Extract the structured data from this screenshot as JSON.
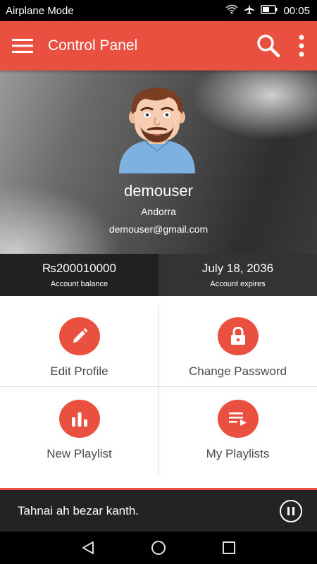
{
  "status_bar": {
    "mode": "Airplane Mode",
    "time": "00:05",
    "icons": [
      "wifi-icon",
      "airplane-icon",
      "battery-icon"
    ]
  },
  "app_bar": {
    "title": "Control Panel",
    "icons": [
      "menu-icon",
      "search-icon",
      "more-vert-icon"
    ]
  },
  "profile": {
    "username": "demouser",
    "country": "Andorra",
    "email": "demouser@gmail.com"
  },
  "stats": {
    "balance_value": "₨200010000",
    "balance_label": "Account balance",
    "expires_value": "July 18, 2036",
    "expires_label": "Account expires"
  },
  "actions": {
    "edit_profile": {
      "label": "Edit Profile",
      "icon": "pencil-icon"
    },
    "change_password": {
      "label": "Change Password",
      "icon": "lock-icon"
    },
    "new_playlist": {
      "label": "New Playlist",
      "icon": "bar-chart-icon"
    },
    "my_playlists": {
      "label": "My Playlists",
      "icon": "playlist-icon"
    }
  },
  "player": {
    "track": "Tahnai ah bezar kanth.",
    "state_icon": "pause-icon"
  },
  "nav_bar": {
    "icons": [
      "back-icon",
      "home-icon",
      "recents-icon"
    ]
  },
  "colors": {
    "accent": "#e9503f",
    "status_bar": "#000000",
    "stat_left": "#212121",
    "stat_right": "#333333",
    "player": "#232323"
  }
}
